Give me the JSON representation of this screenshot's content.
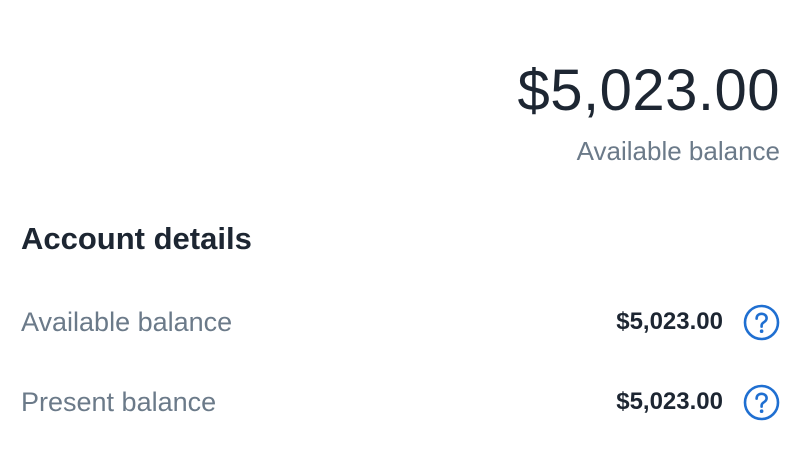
{
  "summary": {
    "balance": "$5,023.00",
    "caption": "Available balance"
  },
  "details": {
    "title": "Account details",
    "rows": [
      {
        "label": "Available balance",
        "value": "$5,023.00",
        "icon": "help-circle-icon"
      },
      {
        "label": "Present balance",
        "value": "$5,023.00",
        "icon": "help-circle-icon"
      }
    ]
  },
  "colors": {
    "accent": "#1f6fd1",
    "text_primary": "#1d2632",
    "text_secondary": "#6b7a89"
  }
}
